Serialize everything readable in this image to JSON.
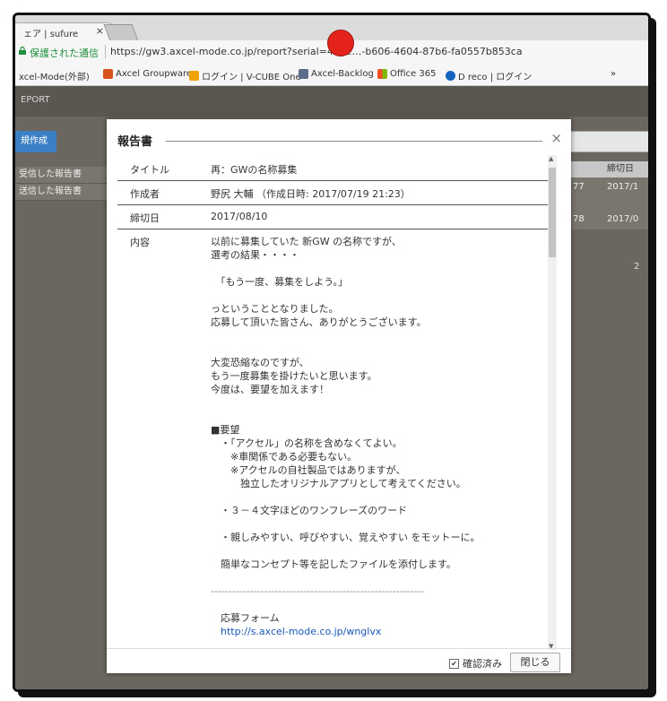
{
  "browser": {
    "tab_title": "ェア | sufure",
    "tab_close": "×",
    "secure_label": "保護された通信",
    "url": "https://gw3.axcel-mode.co.jp/report?serial=44ee…-b606-4604-87b6-fa0557b853ca",
    "bookmarks": [
      {
        "label": "xcel-Mode(外部)",
        "color": ""
      },
      {
        "label": "Axcel Groupware",
        "color": "#d9531e"
      },
      {
        "label": "ログイン | V-CUBE One",
        "color": "#f0a30a"
      },
      {
        "label": "Axcel-Backlog",
        "color": "#5a6b8c"
      },
      {
        "label": "Office 365",
        "color": "#e04a2a"
      },
      {
        "label": "D reco | ログイン",
        "color": "#1565c0"
      }
    ],
    "bookmarks_more": "»"
  },
  "app": {
    "header": "EPORT",
    "new_button": "規作成",
    "sidebar": [
      "受信した報告書",
      "送信した報告書"
    ],
    "table_header": "締切日",
    "table_rows": [
      {
        "id": "77",
        "date": "2017/1"
      },
      {
        "id": "78",
        "date": "2017/0"
      }
    ],
    "page_num": "2"
  },
  "modal": {
    "title": "報告書",
    "close": "×",
    "fields": [
      {
        "label": "タイトル",
        "value": "再：GWの名称募集"
      },
      {
        "label": "作成者",
        "value": "野尻 大輔 （作成日時: 2017/07/19 21:23）"
      },
      {
        "label": "締切日",
        "value": "2017/08/10"
      }
    ],
    "body_label": "内容",
    "body_lines": [
      "以前に募集していた 新GW の名称ですが、",
      "選考の結果・・・・",
      "",
      "　「もう一度、募集をしよう。」",
      "",
      "っということとなりました。",
      "応募して頂いた皆さん、ありがとうございます。",
      "",
      "",
      "大変恐縮なのですが、",
      "もう一度募集を掛けたいと思います。",
      "今度は、要望を加えます！",
      "",
      "",
      "■要望",
      "　・「アクセル」の名称を含めなくてよい。",
      "　　※車関係である必要もない。",
      "　　※アクセルの自社製品ではありますが、",
      "　　　独立したオリジナルアプリとして考えてください。",
      "",
      "　・３－４文字ほどのワンフレーズのワード",
      "",
      "　・親しみやすい、呼びやすい、覚えやすい をモットーに。",
      "",
      "　簡単なコンセプト等を記したファイルを添付します。",
      "",
      "------------------------------------------------------------",
      "",
      "　応募フォーム"
    ],
    "link": "　http://s.axcel-mode.co.jp/wnglvx",
    "confirmed_label": "確認済み",
    "close_button": "閉じる"
  }
}
